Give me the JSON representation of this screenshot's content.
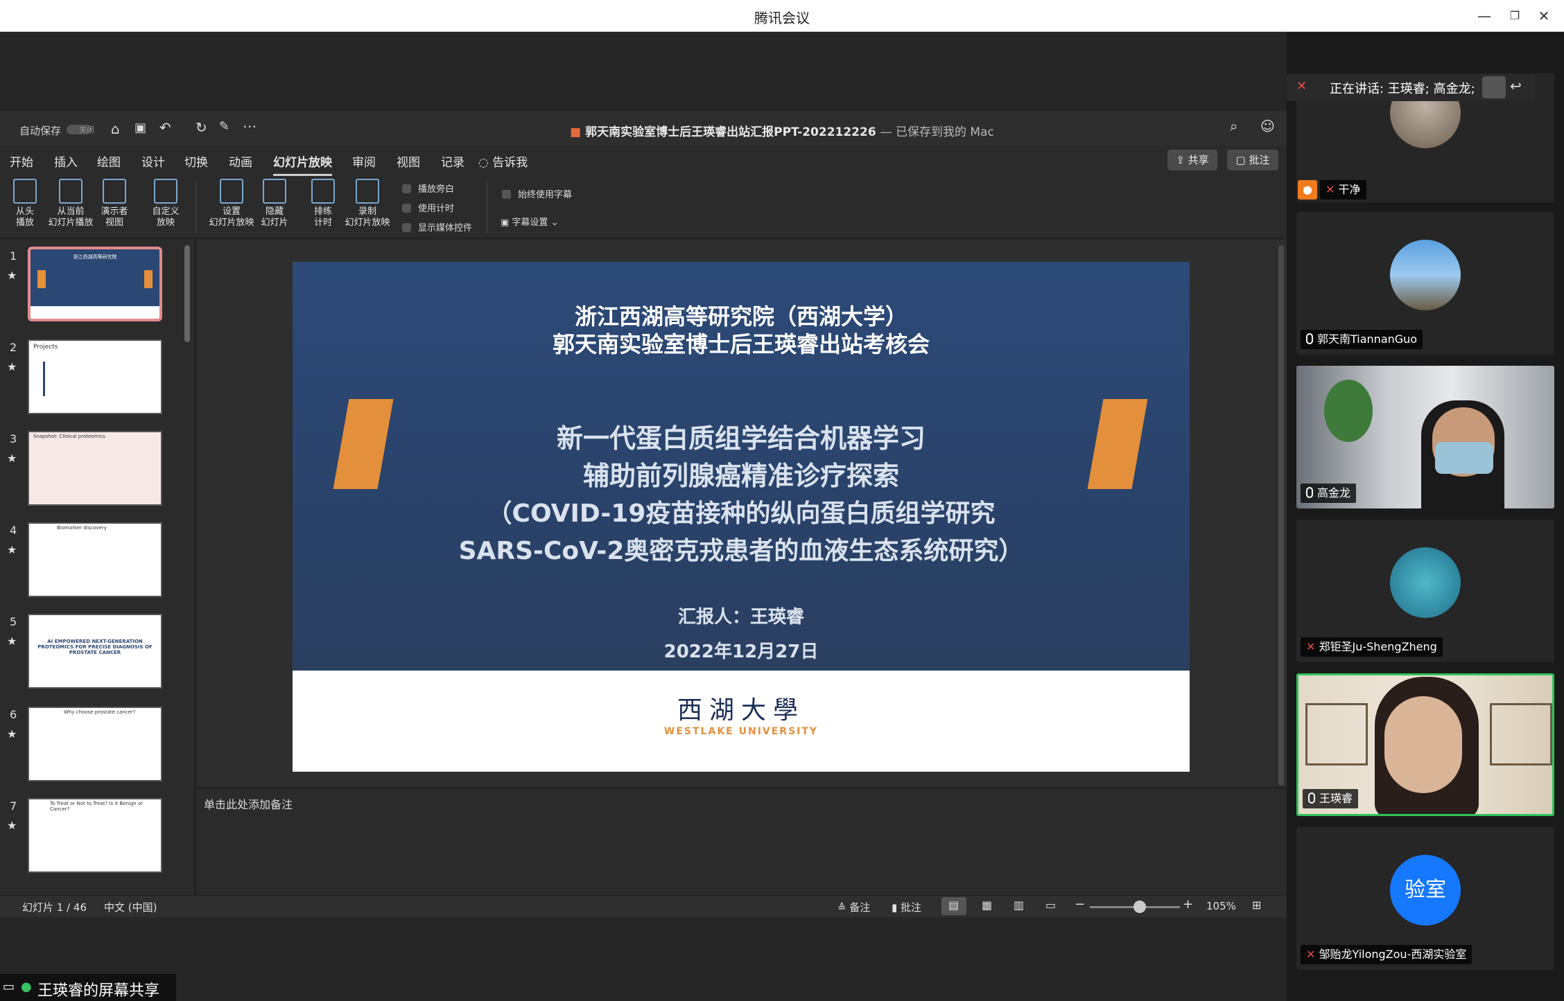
{
  "window": {
    "title": "腾讯会议"
  },
  "ppt": {
    "autosave_label": "自动保存",
    "autosave_state": "关闭",
    "doc_title": "郭天南实验室博士后王瑛睿出站汇报PPT-202212226",
    "doc_saved": "— 已保存到我的 Mac",
    "tabs": [
      "开始",
      "插入",
      "绘图",
      "设计",
      "切换",
      "动画",
      "幻灯片放映",
      "审阅",
      "视图",
      "记录"
    ],
    "tell_me": "告诉我",
    "share_btn": "共享",
    "comment_btn": "批注",
    "ribbon": {
      "from_start": [
        "从头",
        "播放"
      ],
      "from_current": [
        "从当前",
        "幻灯片播放"
      ],
      "presenter": [
        "演示者",
        "视图"
      ],
      "custom": [
        "自定义",
        "放映"
      ],
      "setup": [
        "设置",
        "幻灯片放映"
      ],
      "hide": [
        "隐藏",
        "幻灯片"
      ],
      "rehearse": [
        "排练",
        "计时"
      ],
      "record": [
        "录制",
        "幻灯片放映"
      ],
      "play_narration": "播放旁白",
      "use_timings": "使用计时",
      "show_media": "显示媒体控件",
      "always_subtitles": "始终使用字幕",
      "subtitle_settings": "字幕设置"
    },
    "thumbnails": [
      {
        "num": "1",
        "caption": "浙江西湖高等研究院"
      },
      {
        "num": "2",
        "caption": "Projects"
      },
      {
        "num": "3",
        "caption": "Snapshot: Clinical proteomics"
      },
      {
        "num": "4",
        "caption": "Biomarker discovery"
      },
      {
        "num": "5",
        "caption": "AI EMPOWERED NEXT-GENERATION PROTEOMICS FOR PRECISE DIAGNOSIS OF PROSTATE CANCER"
      },
      {
        "num": "6",
        "caption": "Why choose prostate cancer?"
      },
      {
        "num": "7",
        "caption": "To Treat or Not to Treat? Is it Benign or Cancer?"
      }
    ],
    "slide": {
      "line1": "浙江西湖高等研究院（西湖大学）",
      "line2": "郭天南实验室博士后王瑛睿出站考核会",
      "title1": "新一代蛋白质组学结合机器学习",
      "title2": "辅助前列腺癌精准诊疗探索",
      "title3": "（COVID-19疫苗接种的纵向蛋白质组学研究",
      "title4": "SARS-CoV-2奥密克戎患者的血液生态系统研究）",
      "reporter": "汇报人：王瑛睿",
      "date": "2022年12月27日",
      "logo_cn": "西湖大學",
      "logo_en": "WESTLAKE UNIVERSITY"
    },
    "notes_placeholder": "单击此处添加备注",
    "status": {
      "slide_pos": "幻灯片 1 / 46",
      "language": "中文 (中国)",
      "notes": "备注",
      "comments": "批注",
      "zoom": "105%",
      "zoom_fraction": 0.55
    }
  },
  "share_label": "王瑛睿的屏幕共享",
  "speaking": "正在讲话: 王瑛睿; 高金龙;",
  "participants": [
    {
      "name": "干净",
      "muted": true
    },
    {
      "name": "郭天南TiannanGuo",
      "muted": false
    },
    {
      "name": "高金龙",
      "muted": false
    },
    {
      "name": "郑钜圣Ju-ShengZheng",
      "muted": true
    },
    {
      "name": "王瑛睿",
      "muted": false
    },
    {
      "name": "邹贻龙YilongZou-西湖实验室",
      "muted": true,
      "avatar_text": "验室"
    }
  ],
  "colors": {
    "slide_blue": "#2b4773",
    "accent_orange": "#e38f3b",
    "avatar_blue": "#1677ff",
    "speaker_border": "#31c25b"
  }
}
